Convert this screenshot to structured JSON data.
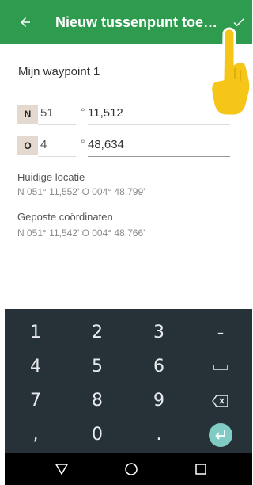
{
  "appbar": {
    "title": "Nieuw tussenpunt toevo...",
    "back_icon": "arrow-left-icon",
    "confirm_icon": "check-icon",
    "color": "#2e9b4e"
  },
  "form": {
    "name_value": "Mijn waypoint 1",
    "hint_char": "!",
    "latitude": {
      "hemisphere": "N",
      "degrees": "51",
      "degree_symbol": "°",
      "minutes": "11,512"
    },
    "longitude": {
      "hemisphere": "O",
      "degrees": "4",
      "degree_symbol": "°",
      "minutes": "48,634"
    }
  },
  "info": {
    "current_location_label": "Huidige locatie",
    "current_location_value": "N 051° 11,552'  O 004° 48,799'",
    "posted_label": "Geposte coördinaten",
    "posted_value": "N 051° 11,542'  O 004° 48,766'"
  },
  "keyboard": {
    "rows": [
      [
        "1",
        "2",
        "3",
        "–"
      ],
      [
        "4",
        "5",
        "6",
        "space"
      ],
      [
        "7",
        "8",
        "9",
        "backspace"
      ],
      [
        ",",
        "0",
        ".",
        "enter"
      ]
    ],
    "background": "#263238",
    "enter_color": "#80cbc4"
  },
  "navbar": {
    "icons": [
      "back-triangle-icon",
      "home-circle-icon",
      "recents-square-icon"
    ]
  }
}
